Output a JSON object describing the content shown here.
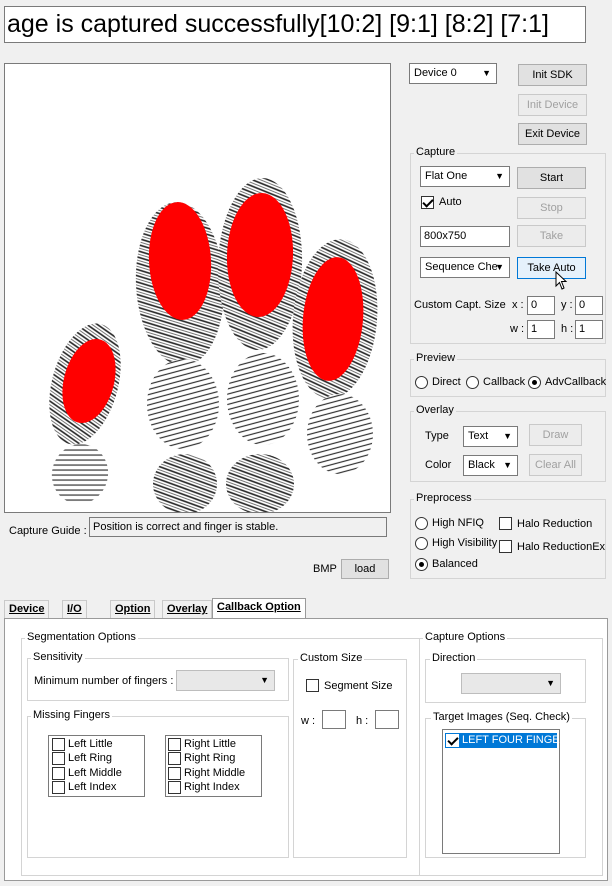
{
  "status": {
    "message": "age is captured successfully[10:2] [9:1] [8:2] [7:1]"
  },
  "device": {
    "selected": "Device 0",
    "init_sdk": "Init SDK",
    "init_device": "Init Device",
    "exit_device": "Exit Device"
  },
  "capture": {
    "title": "Capture",
    "mode": "Flat One",
    "auto_label": "Auto",
    "resolution": "800x750",
    "sequence": "Sequence Che",
    "start": "Start",
    "stop": "Stop",
    "take": "Take",
    "take_auto": "Take Auto",
    "custom_size_label": "Custom Capt. Size",
    "x_label": "x :",
    "x_value": "0",
    "y_label": "y :",
    "y_value": "0",
    "w_label": "w :",
    "w_value": "1",
    "h_label": "h :",
    "h_value": "1"
  },
  "preview": {
    "title": "Preview",
    "direct": "Direct",
    "callback": "Callback",
    "adv_callback": "AdvCallback"
  },
  "overlay": {
    "title": "Overlay",
    "type_label": "Type",
    "type_value": "Text",
    "color_label": "Color",
    "color_value": "Black",
    "draw": "Draw",
    "clear_all": "Clear All"
  },
  "preprocess": {
    "title": "Preprocess",
    "high_nfiq": "High NFIQ",
    "high_visibility": "High Visibility",
    "balanced": "Balanced",
    "halo_reduction": "Halo Reduction",
    "halo_reduction_ex": "Halo ReductionEx"
  },
  "guide": {
    "label": "Capture Guide :",
    "message": "Position is correct and finger is stable."
  },
  "bmp": {
    "label": "BMP",
    "load": "load"
  },
  "tabs": [
    "Device",
    "I/O",
    "Option",
    "Overlay",
    "Callback Option"
  ],
  "segmentation": {
    "title": "Segmentation Options",
    "sensitivity_title": "Sensitivity",
    "min_fingers_label": "Minimum number of fingers :",
    "missing_title": "Missing Fingers",
    "left": [
      "Left Little",
      "Left Ring",
      "Left Middle",
      "Left Index"
    ],
    "right": [
      "Right Little",
      "Right Ring",
      "Right Middle",
      "Right Index"
    ]
  },
  "custom_size": {
    "title": "Custom Size",
    "segment_size": "Segment Size",
    "w_label": "w :",
    "h_label": "h :"
  },
  "capture_options": {
    "title": "Capture Options",
    "direction_title": "Direction",
    "target_title": "Target Images (Seq. Check)",
    "target_item": "LEFT FOUR FINGER"
  },
  "colors": {
    "accent": "#0078d7",
    "finger_highlight": "#ff0000"
  }
}
